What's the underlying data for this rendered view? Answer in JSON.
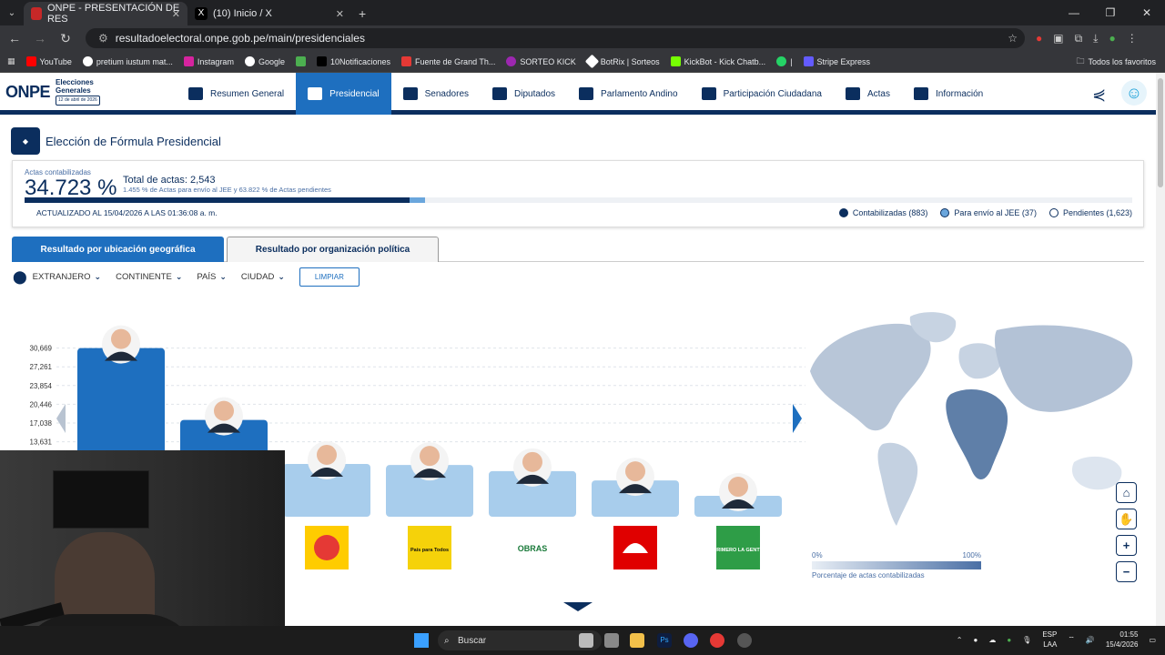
{
  "browser": {
    "tabs": [
      {
        "label": "ONPE - PRESENTACIÓN DE RES",
        "active": true,
        "icon": "onpe-favicon"
      },
      {
        "label": "(10) Inicio / X",
        "active": false,
        "icon": "x-logo-icon"
      }
    ],
    "url": "resultadoelectoral.onpe.gob.pe/main/presidenciales",
    "bookmarks": [
      "YouTube",
      "pretium iustum mat...",
      "Instagram",
      "Google",
      "",
      "10Notificaciones",
      "Fuente de Grand Th...",
      "SORTEO KICK",
      "BotRix | Sorteos",
      "KickBot - Kick Chatb...",
      "|",
      "Stripe Express"
    ],
    "bookmarks_right": "Todos los favoritos"
  },
  "site": {
    "logo_text": "ONPE",
    "logo_sub1": "Elecciones",
    "logo_sub2": "Generales",
    "logo_date": "12 de abril de 2026",
    "menu": [
      {
        "label": "Resumen General",
        "icon": "dashboard-icon"
      },
      {
        "label": "Presidencial",
        "icon": "president-icon",
        "active": true
      },
      {
        "label": "Senadores",
        "icon": "senate-icon"
      },
      {
        "label": "Diputados",
        "icon": "congress-icon"
      },
      {
        "label": "Parlamento Andino",
        "icon": "andean-icon"
      },
      {
        "label": "Participación Ciudadana",
        "icon": "people-icon"
      },
      {
        "label": "Actas",
        "icon": "checklist-icon"
      },
      {
        "label": "Información",
        "icon": "info-icon"
      }
    ],
    "page_title": "Elección de Fórmula Presidencial"
  },
  "summary": {
    "label": "Actas contabilizadas",
    "percent": "34.723 %",
    "total": "Total de actas: 2,543",
    "sub": "1.455 % de Actas para envío al JEE y 63.822 % de Actas pendientes",
    "counted_fraction": 0.34723,
    "jee_fraction": 0.01455,
    "updated": "ACTUALIZADO AL 15/04/2026 A LAS 01:36:08 a. m.",
    "legend": [
      {
        "label": "Contabilizadas (883)",
        "color": "#0b2e5e"
      },
      {
        "label": "Para envío al JEE (37)",
        "color": "#6aa6dc"
      },
      {
        "label": "Pendientes (1,623)",
        "color": "#ffffff"
      }
    ]
  },
  "result_tabs": [
    "Resultado por ubicación geográfica",
    "Resultado por organización política"
  ],
  "filters": {
    "items": [
      "EXTRANJERO",
      "CONTINENTE",
      "PAÍS",
      "CIUDAD"
    ],
    "clear": "LIMPIAR"
  },
  "chart_data": {
    "type": "bar",
    "y_ticks": [
      "30,669",
      "27,261",
      "23,854",
      "20,446",
      "17,038",
      "13,631"
    ],
    "ylim": [
      0,
      34077
    ],
    "values": [
      30669,
      17600,
      9600,
      9400,
      8300,
      6600,
      3800
    ],
    "colors": [
      "#1e6fbf",
      "#1e6fbf",
      "#a8cdec",
      "#a8cdec",
      "#a8cdec",
      "#a8cdec",
      "#a8cdec"
    ],
    "party_logos": [
      "",
      "",
      "sun-logo",
      "road-logo",
      "obras-logo",
      "helmet-logo",
      "primero-la-gente-logo"
    ],
    "party_logo_text": [
      "",
      "",
      "",
      "País para Todos",
      "OBRAS",
      "",
      "PRIMERO LA GENTE"
    ]
  },
  "map": {
    "scale_min": "0%",
    "scale_max": "100%",
    "caption": "Porcentaje de actas contabilizadas"
  },
  "taskbar": {
    "search": "Buscar",
    "lang": "ESP",
    "lang2": "LAA",
    "time": "01:55",
    "date": "15/4/2026"
  }
}
